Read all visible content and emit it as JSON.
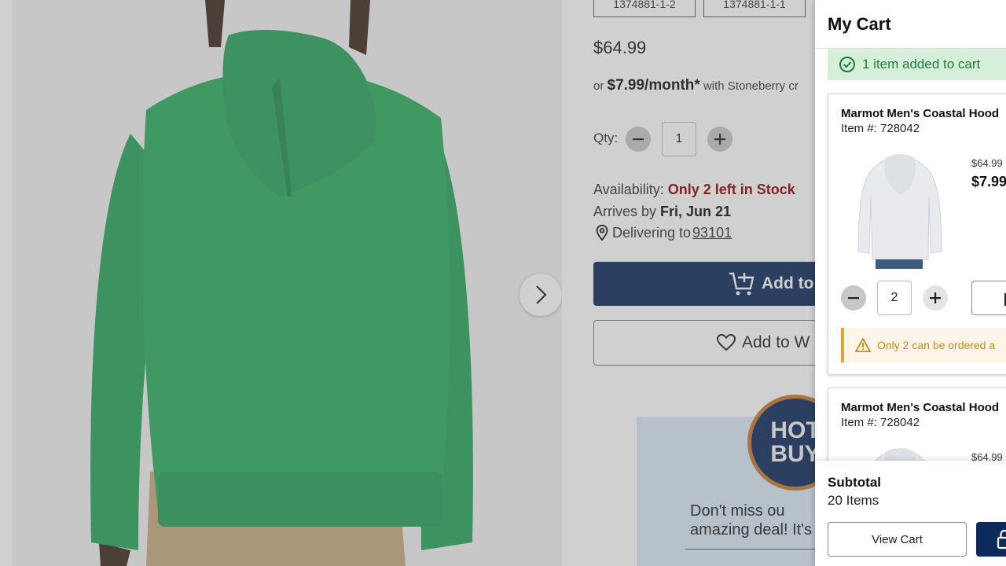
{
  "product": {
    "variants": [
      "1374881-1-2",
      "1374881-1-1"
    ],
    "price": "$64.99",
    "monthly_prefix": "or",
    "monthly_amount": "$7.99/month*",
    "monthly_suffix": "with Stoneberry cr",
    "qty_label": "Qty:",
    "qty_value": "1",
    "availability_label": "Availability:",
    "availability_value": "Only 2 left in Stock",
    "arrives_label": "Arrives by",
    "arrives_date": "Fri, Jun 21",
    "delivering_label": "Delivering to",
    "zip": "93101",
    "add_to_cart_label": "Add to",
    "wishlist_label": "Add to W",
    "promo_badge_line1": "HOT",
    "promo_badge_line2": "BUY",
    "promo_text_line1": "Don't miss ou",
    "promo_text_line2": "amazing deal! It's"
  },
  "cart": {
    "title": "My Cart",
    "added_message": "1 item added to cart",
    "items": [
      {
        "name": "Marmot Men's Coastal Hood",
        "item_number": "Item #: 728042",
        "old_price": "$64.99",
        "new_price": "$7.99",
        "qty": "2",
        "limit_note": "Only 2 can be ordered a"
      },
      {
        "name": "Marmot Men's Coastal Hood",
        "item_number": "Item #: 728042",
        "old_price": "$64.99"
      }
    ],
    "subtotal_label": "Subtotal",
    "items_count": "20 Items",
    "view_cart_label": "View Cart"
  },
  "colors": {
    "navy": "#0d2a5c",
    "success_green": "#1e7a3a",
    "stock_red": "#8b0000",
    "warning_amber": "#c88a1a"
  }
}
